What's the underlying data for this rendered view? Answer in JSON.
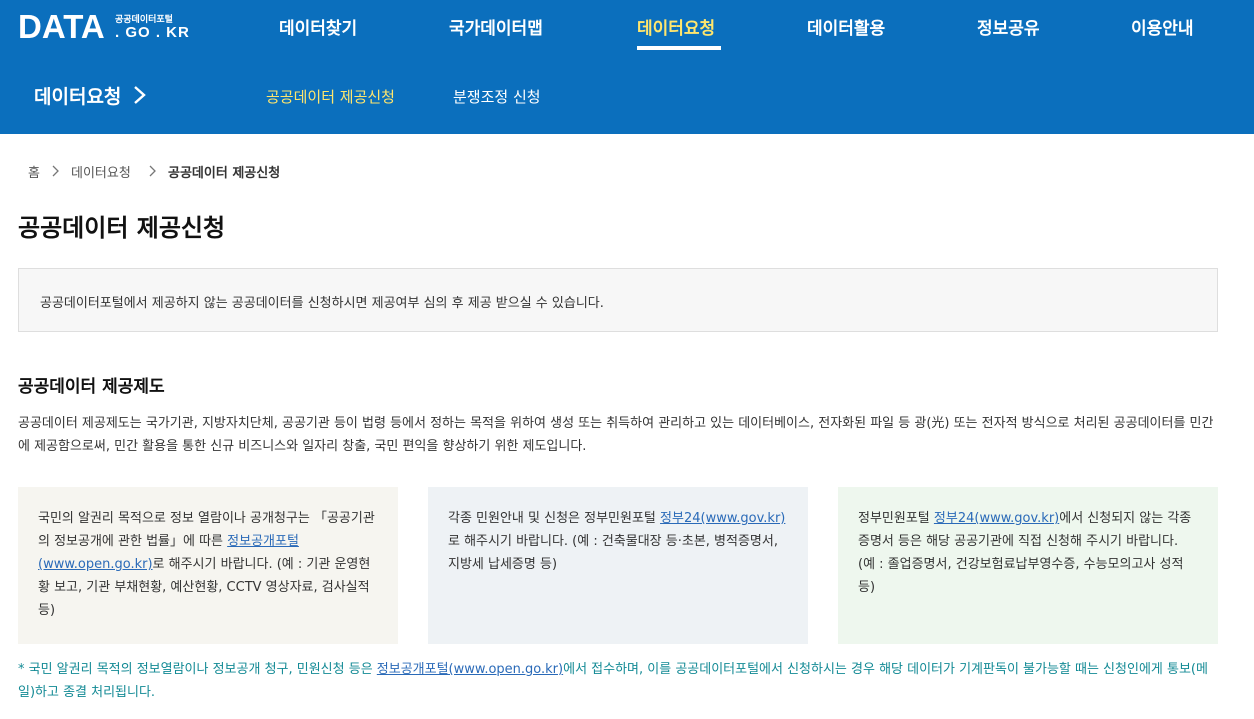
{
  "header": {
    "logo": {
      "main": "DATA",
      "sub_top": "공공데이터포털",
      "sub_bottom": ". GO . KR"
    },
    "nav": [
      {
        "label": "데이터찾기",
        "active": false
      },
      {
        "label": "국가데이터맵",
        "active": false
      },
      {
        "label": "데이터요청",
        "active": true
      },
      {
        "label": "데이터활용",
        "active": false
      },
      {
        "label": "정보공유",
        "active": false
      },
      {
        "label": "이용안내",
        "active": false
      }
    ],
    "colors": {
      "background": "#0b6fbd",
      "active": "#ffe66d"
    }
  },
  "subnav": {
    "title": "데이터요청",
    "links": [
      {
        "label": "공공데이터 제공신청",
        "active": true
      },
      {
        "label": "분쟁조정 신청",
        "active": false
      }
    ]
  },
  "breadcrumb": {
    "home": "홈",
    "items": [
      "데이터요청",
      "공공데이터 제공신청"
    ]
  },
  "page_title": "공공데이터 제공신청",
  "notice": "공공데이터포털에서 제공하지 않는 공공데이터를 신청하시면 제공여부 심의 후 제공 받으실 수 있습니다.",
  "section": {
    "title": "공공데이터 제공제도",
    "description": "공공데이터 제공제도는 국가기관, 지방자치단체, 공공기관 등이 법령 등에서 정하는 목적을 위하여 생성 또는 취득하여 관리하고 있는 데이터베이스, 전자화된 파일 등 광(光) 또는 전자적 방식으로 처리된 공공데이터를 민간에 제공함으로써, 민간 활용을 통한 신규 비즈니스와 일자리 창출, 국민 편익을 향상하기 위한 제도입니다."
  },
  "info_boxes": [
    {
      "text_before": "국민의 알권리 목적으로 정보 열람이나 공개청구는 「공공기관의 정보공개에 관한 법률」에 따른 ",
      "link": "정보공개포털(www.open.go.kr)",
      "text_after": "로 해주시기 바랍니다. (예 : 기관 운영현황 보고, 기관 부채현황, 예산현황, CCTV 영상자료, 검사실적 등)",
      "color": "#f6f5f0"
    },
    {
      "text_before": "각종 민원안내 및 신청은 정부민원포털 ",
      "link": "정부24(www.gov.kr)",
      "text_after": "로 해주시기 바랍니다. (예 : 건축물대장 등·초본, 병적증명서, 지방세 납세증명 등)",
      "color": "#eef2f5"
    },
    {
      "text_before": "정부민원포털 ",
      "link": "정부24(www.gov.kr)",
      "text_after": "에서 신청되지 않는 각종 증명서 등은 해당 공공기관에 직접 신청해 주시기 바랍니다.",
      "line2": "(예 : 졸업증명서, 건강보험료납부영수증, 수능모의고사 성적 등)",
      "color": "#eef7ee"
    }
  ],
  "footnote": {
    "text_before": "* 국민 알권리 목적의 정보열람이나 정보공개 청구, 민원신청 등은 ",
    "link": "정보공개포털(www.open.go.kr)",
    "text_after": "에서 접수하며, 이를 공공데이터포털에서 신청하시는 경우 해당 데이터가 기계판독이 불가능할 때는 신청인에게 통보(메일)하고 종결 처리됩니다.",
    "color": "#138a95"
  }
}
